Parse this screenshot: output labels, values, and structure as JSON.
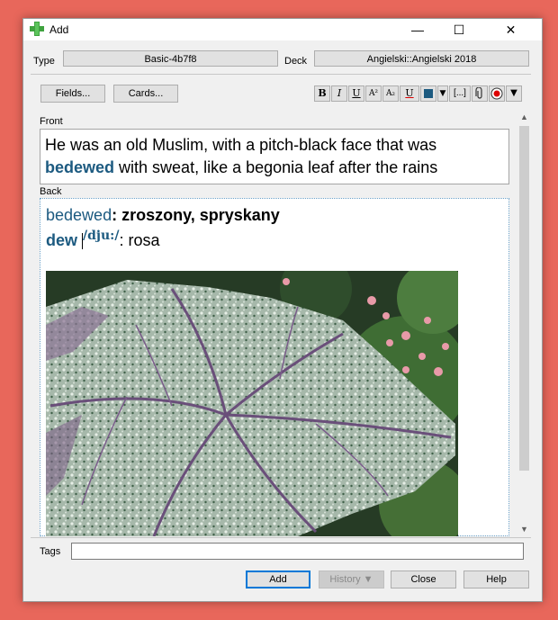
{
  "window": {
    "title": "Add",
    "min_glyph": "—",
    "max_glyph": "☐",
    "close_glyph": "✕"
  },
  "type": {
    "label": "Type",
    "value": "Basic-4b7f8"
  },
  "deck": {
    "label": "Deck",
    "value": "Angielski::Angielski 2018"
  },
  "buttons": {
    "fields": "Fields...",
    "cards": "Cards..."
  },
  "toolbar": {
    "bold": "B",
    "italic": "I",
    "underline": "U",
    "superscript": "A²",
    "subscript": "A₂",
    "clear_format": "U",
    "more": "[...]"
  },
  "colors": {
    "accent": "#1c5a80",
    "text_color": "#1c5a80"
  },
  "fields": {
    "front_label": "Front",
    "front_text_1": "He was an old Muslim, with a pitch-black face that was",
    "front_highlight": "bedewed",
    "front_text_2": " with sweat, like a begonia leaf after the rains",
    "back_label": "Back",
    "back_be": "be",
    "back_dewed": "dewed",
    "back_def": ": zroszony, spryskany",
    "back_dew": "dew",
    "back_ipa": "/dju:/",
    "back_def2": ": rosa"
  },
  "tags": {
    "label": "Tags",
    "value": ""
  },
  "bottom": {
    "add": "Add",
    "history": "History ▼",
    "close": "Close",
    "help": "Help"
  }
}
